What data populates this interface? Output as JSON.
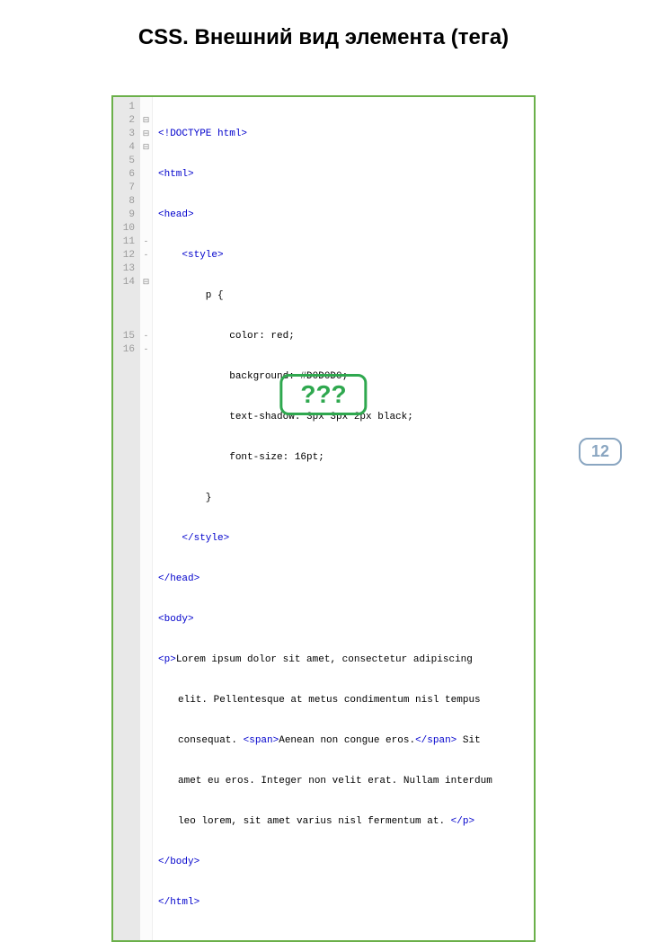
{
  "title": "CSS. Внешний вид элемента (тега)",
  "code": {
    "line_numbers": [
      "1",
      "2",
      "3",
      "4",
      "5",
      "6",
      "7",
      "8",
      "9",
      "10",
      "11",
      "12",
      "13",
      "14",
      "",
      "",
      "",
      "15",
      "16"
    ],
    "fold": [
      "",
      "⊟",
      "⊟",
      "⊟",
      "",
      "",
      "",
      "",
      "",
      "",
      "-",
      "-",
      "",
      "⊟",
      "",
      "",
      "",
      "-",
      "-"
    ],
    "doctype": "<!DOCTYPE html>",
    "html_open": "<html>",
    "head_open": "<head>",
    "style_open": "    <style>",
    "rule_selector": "        p {",
    "rule_color": "            color: red;",
    "rule_background": "            background: #D0D0D0;",
    "rule_shadow": "            text-shadow: 3px 3px 2px black;",
    "rule_fontsize": "            font-size: 16pt;",
    "rule_close": "        }",
    "style_close": "    </style>",
    "head_close": "</head>",
    "body_open": "<body>",
    "p_open": "<p>",
    "para_text_1": "Lorem ipsum dolor sit amet, consectetur adipiscing",
    "para_wrap_2": "elit. Pellentesque at metus condimentum nisl tempus",
    "para_wrap_3a": "consequat. ",
    "span_open": "<span>",
    "para_wrap_3b": "Aenean non congue eros.",
    "span_close": "</span>",
    "para_wrap_3c": " Sit",
    "para_wrap_4": "amet eu eros. Integer non velit erat. Nullam interdum",
    "para_wrap_5": "leo lorem, sit amet varius nisl fermentum at. ",
    "p_close": "</p>",
    "body_close": "</body>",
    "html_close": "</html>"
  },
  "question": "???",
  "page_number": "12"
}
